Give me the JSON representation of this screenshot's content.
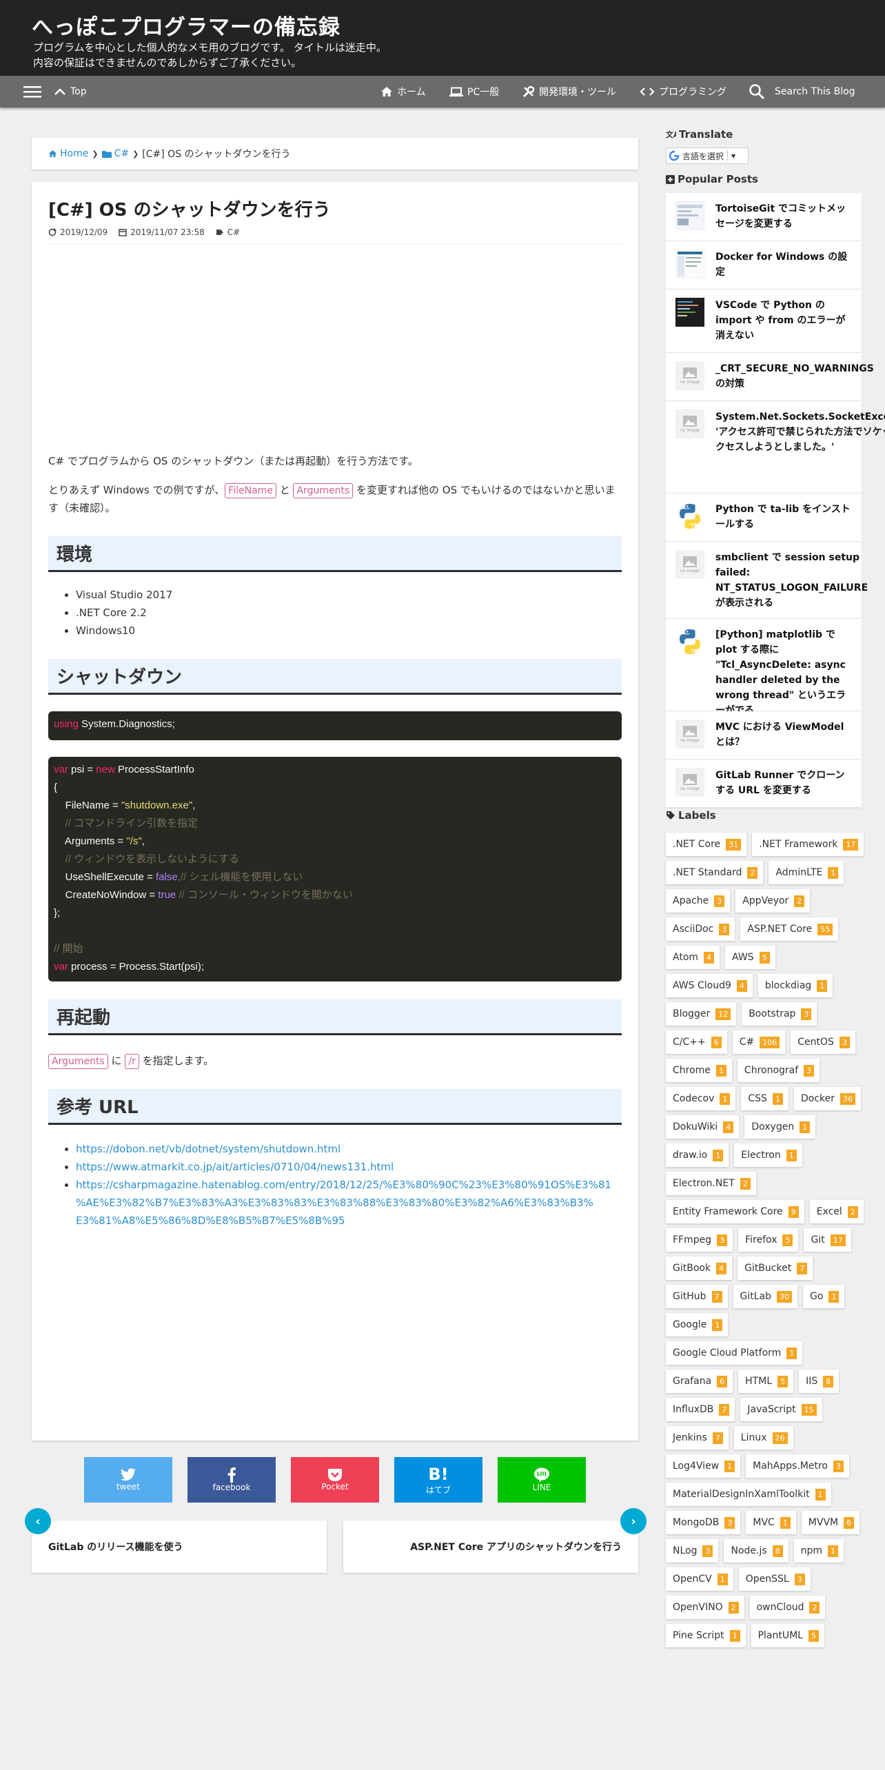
{
  "header": {
    "title": "へっぽこプログラマーの備忘録",
    "desc_line1": "プログラムを中心とした個人的なメモ用のブログです。 タイトルは迷走中。",
    "desc_line2": "内容の保証はできませんのであしからずご了承ください。"
  },
  "nav": {
    "top": "Top",
    "home": "ホーム",
    "pc": "PC一般",
    "dev": "開発環境・ツール",
    "programming": "プログラミング",
    "search": "Search This Blog"
  },
  "breadcrumb": {
    "home": "Home",
    "category": "C#",
    "current": "[C#] OS のシャットダウンを行う"
  },
  "post": {
    "title": "[C#] OS のシャットダウンを行う",
    "updated": "2019/12/09",
    "published": "2019/11/07 23:58",
    "tag": "C#",
    "intro": "C# でプログラムから OS のシャットダウン（または再起動）を行う方法です。",
    "p2_a": "とりあえず Windows での例ですが、",
    "p2_code1": "FileName",
    "p2_b": " と ",
    "p2_code2": "Arguments",
    "p2_c": " を変更すれば他の OS でもいけるのではないかと思います（未確認）。",
    "h_env": "環境",
    "env": [
      "Visual Studio 2017",
      ".NET Core 2.2",
      "Windows10"
    ],
    "h_shutdown": "シャットダウン",
    "code1_kw": "using",
    "code1_rest": " System.Diagnostics;",
    "c_var": "var",
    "c_psi": " psi = ",
    "c_new": "new",
    "c_psi_type": " ProcessStartInfo",
    "c_open": "{",
    "c_fn": "    FileName = ",
    "c_fn_val": "\"shutdown.exe\"",
    "c_comma": ",",
    "c_cm1": "    // コマンドライン引数を指定",
    "c_args": "    Arguments = ",
    "c_args_val": "\"/s\"",
    "c_cm2": "    // ウィンドウを表示しないようにする",
    "c_use": "    UseShellExecute = ",
    "c_false": "false",
    "c_use_cm": ",// シェル機能を使用しない",
    "c_cnw": "    CreateNoWindow = ",
    "c_true": "true",
    "c_cnw_cm": " // コンソール・ウィンドウを開かない",
    "c_close": "};",
    "c_cm_start": "// 開始",
    "c_var2": "var",
    "c_proc": " process = Process.Start(psi);",
    "h_reboot": "再起動",
    "reboot_code1": "Arguments",
    "reboot_a": " に ",
    "reboot_code2": "/r",
    "reboot_b": " を指定します。",
    "h_ref": "参考 URL",
    "refs": [
      "https://dobon.net/vb/dotnet/system/shutdown.html",
      "https://www.atmarkit.co.jp/ait/articles/0710/04/news131.html",
      "https://csharpmagazine.hatenablog.com/entry/2018/12/25/%E3%80%90C%23%E3%80%91OS%E3%81",
      "%AE%E3%82%B7%E3%83%A3%E3%83%83%E3%83%88%E3%83%80%E3%82%A6%E3%83%B3%",
      "E3%81%A8%E5%86%8D%E8%B5%B7%E5%8B%95"
    ]
  },
  "share": {
    "tweet": "tweet",
    "facebook": "facebook",
    "pocket": "Pocket",
    "hatena_icon": "B!",
    "hatena": "はてブ",
    "line": "LINE"
  },
  "pager": {
    "prev": "GitLab のリリース機能を使う",
    "next": "ASP.NET Core アプリのシャットダウンを行う"
  },
  "sidebar": {
    "translate_heading": "Translate",
    "translate_select": "言語を選択",
    "popular_heading": "Popular Posts",
    "no_image": "no image",
    "popular": [
      "TortoiseGit でコミットメッセージを変更する",
      "Docker for Windows の設定",
      "VSCode で Python の import や from のエラーが消えない",
      "_CRT_SECURE_NO_WARNINGS の対策",
      "System.Net.Sockets.SocketException: 'アクセス許可で禁じられた方法でソケットにアクセスしようとしました。'",
      "Python で ta-lib をインストールする",
      "smbclient で session setup failed: NT_STATUS_LOGON_FAILURE が表示される",
      "[Python] matplotlib で plot する際に \"Tcl_AsyncDelete: async handler deleted by the wrong thread\" というエラーがでる",
      "MVC における ViewModel とは？",
      "GitLab Runner でクローンする URL を変更する"
    ],
    "labels_heading": "Labels",
    "labels": [
      {
        "name": ".NET Core",
        "count": "31"
      },
      {
        "name": ".NET Framework",
        "count": "17"
      },
      {
        "name": ".NET Standard",
        "count": "2"
      },
      {
        "name": "AdminLTE",
        "count": "1"
      },
      {
        "name": "Apache",
        "count": "3"
      },
      {
        "name": "AppVeyor",
        "count": "2"
      },
      {
        "name": "AsciiDoc",
        "count": "3"
      },
      {
        "name": "ASP.NET Core",
        "count": "55"
      },
      {
        "name": "Atom",
        "count": "4"
      },
      {
        "name": "AWS",
        "count": "5"
      },
      {
        "name": "AWS Cloud9",
        "count": "4"
      },
      {
        "name": "blockdiag",
        "count": "1"
      },
      {
        "name": "Blogger",
        "count": "12"
      },
      {
        "name": "Bootstrap",
        "count": "3"
      },
      {
        "name": "C/C++",
        "count": "6"
      },
      {
        "name": "C#",
        "count": "106"
      },
      {
        "name": "CentOS",
        "count": "3"
      },
      {
        "name": "Chrome",
        "count": "1"
      },
      {
        "name": "Chronograf",
        "count": "3"
      },
      {
        "name": "Codecov",
        "count": "1"
      },
      {
        "name": "CSS",
        "count": "1"
      },
      {
        "name": "Docker",
        "count": "36"
      },
      {
        "name": "DokuWiki",
        "count": "4"
      },
      {
        "name": "Doxygen",
        "count": "1"
      },
      {
        "name": "draw.io",
        "count": "1"
      },
      {
        "name": "Electron",
        "count": "1"
      },
      {
        "name": "Electron.NET",
        "count": "2"
      },
      {
        "name": "Entity Framework Core",
        "count": "9"
      },
      {
        "name": "Excel",
        "count": "2"
      },
      {
        "name": "FFmpeg",
        "count": "3"
      },
      {
        "name": "Firefox",
        "count": "5"
      },
      {
        "name": "Git",
        "count": "17"
      },
      {
        "name": "GitBook",
        "count": "4"
      },
      {
        "name": "GitBucket",
        "count": "7"
      },
      {
        "name": "GitHub",
        "count": "7"
      },
      {
        "name": "GitLab",
        "count": "30"
      },
      {
        "name": "Go",
        "count": "1"
      },
      {
        "name": "Google",
        "count": "1"
      },
      {
        "name": "Google Cloud Platform",
        "count": "1"
      },
      {
        "name": "Grafana",
        "count": "6"
      },
      {
        "name": "HTML",
        "count": "5"
      },
      {
        "name": "IIS",
        "count": "8"
      },
      {
        "name": "InfluxDB",
        "count": "7"
      },
      {
        "name": "JavaScript",
        "count": "15"
      },
      {
        "name": "Jenkins",
        "count": "7"
      },
      {
        "name": "Linux",
        "count": "26"
      },
      {
        "name": "Log4View",
        "count": "1"
      },
      {
        "name": "MahApps.Metro",
        "count": "3"
      },
      {
        "name": "MaterialDesignInXamlToolkit",
        "count": "1"
      },
      {
        "name": "MongoDB",
        "count": "3"
      },
      {
        "name": "MVC",
        "count": "1"
      },
      {
        "name": "MVVM",
        "count": "6"
      },
      {
        "name": "NLog",
        "count": "3"
      },
      {
        "name": "Node.js",
        "count": "8"
      },
      {
        "name": "npm",
        "count": "1"
      },
      {
        "name": "OpenCV",
        "count": "1"
      },
      {
        "name": "OpenSSL",
        "count": "3"
      },
      {
        "name": "OpenVINO",
        "count": "2"
      },
      {
        "name": "ownCloud",
        "count": "2"
      },
      {
        "name": "Pine Script",
        "count": "1"
      },
      {
        "name": "PlantUML",
        "count": "5"
      }
    ]
  },
  "colors": {
    "header_bg": "#232323",
    "nav_bg": "#6b6b6b",
    "link": "#2a8fd0",
    "label_count": "#f5a623",
    "twitter": "#55acee",
    "facebook": "#3b5998",
    "pocket": "#ef4056",
    "hatena": "#008fde",
    "line": "#00c300",
    "pager_btn": "#00aad3"
  }
}
